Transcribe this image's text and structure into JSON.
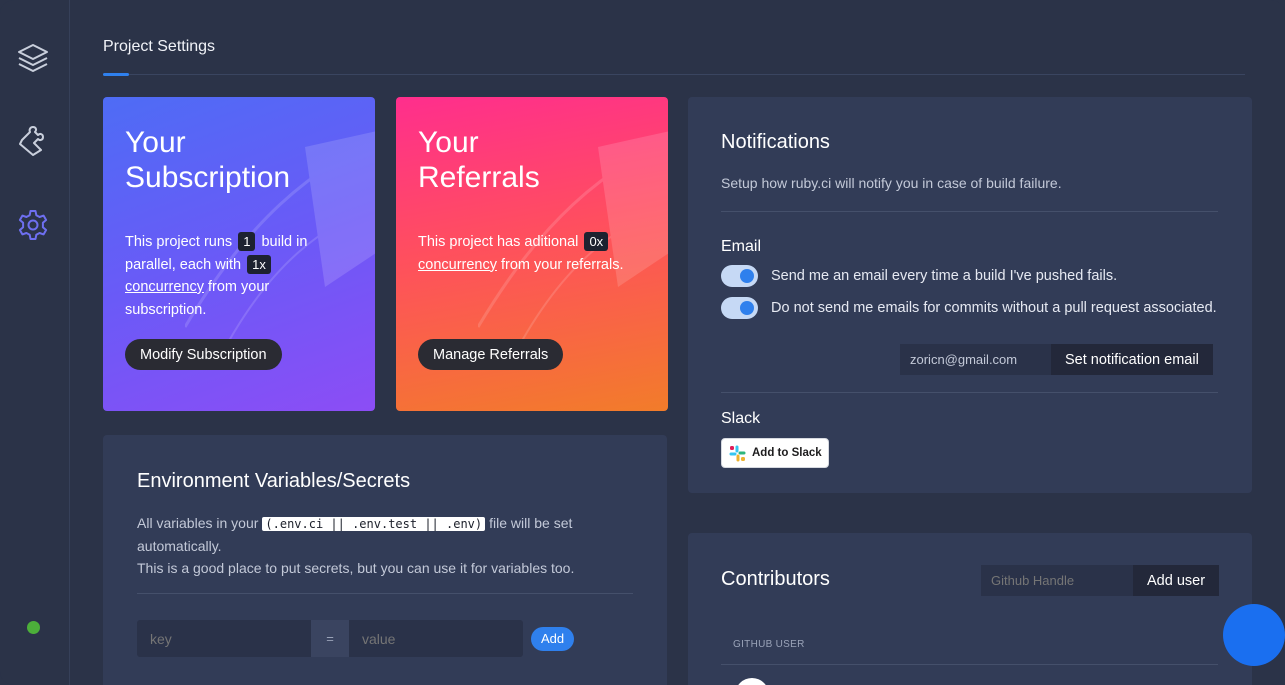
{
  "sidebar": {
    "items": [
      {
        "icon": "layers-icon"
      },
      {
        "icon": "puzzle-icon"
      },
      {
        "icon": "gear-icon"
      }
    ],
    "status_color": "#4caf3a"
  },
  "header": {
    "title": "Project Settings"
  },
  "subscription": {
    "title_line1": "Your",
    "title_line2": "Subscription",
    "text_a": "This project runs",
    "builds": "1",
    "text_b": "build in parallel, each with",
    "concurrency_value": "1x",
    "link": "concurrency",
    "text_c": "from your subscription.",
    "button": "Modify Subscription"
  },
  "referrals": {
    "title_line1": "Your",
    "title_line2": "Referrals",
    "text_a": "This project has aditional",
    "concurrency_value": "0x",
    "link": "concurrency",
    "text_b": "from your referrals.",
    "button": "Manage Referrals"
  },
  "notifications": {
    "title": "Notifications",
    "subtitle": "Setup how ruby.ci will notify you in case of build failure.",
    "email_heading": "Email",
    "toggles": [
      {
        "label": "Send me an email every time a build I've pushed fails.",
        "on": true
      },
      {
        "label": "Do not send me emails for commits without a pull request associated.",
        "on": true
      }
    ],
    "email_value": "zoricn@gmail.com",
    "email_button": "Set notification email",
    "slack_heading": "Slack",
    "slack_button": "Add to Slack"
  },
  "env": {
    "title": "Environment Variables/Secrets",
    "desc_a": "All variables in your",
    "code": "(.env.ci || .env.test || .env)",
    "desc_b": "file will be set automatically.",
    "desc_c": "This is a good place to put secrets, but you can use it for variables too.",
    "key_placeholder": "key",
    "equals": "=",
    "value_placeholder": "value",
    "add_button": "Add"
  },
  "contributors": {
    "title": "Contributors",
    "handle_placeholder": "Github Handle",
    "add_button": "Add user",
    "column_header": "GITHUB USER"
  },
  "colors": {
    "accent": "#2f80ed",
    "panel": "#323c57",
    "background": "#2b3348"
  }
}
